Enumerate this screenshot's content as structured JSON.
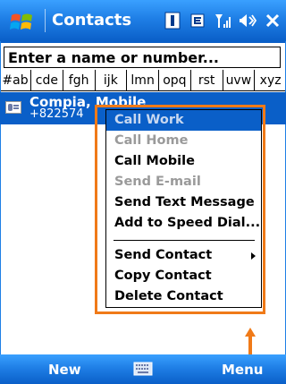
{
  "titlebar": {
    "app_title": "Contacts",
    "icons": [
      "windows-flag-icon",
      "sim-icon",
      "data-icon",
      "signal-icon",
      "speaker-icon",
      "close-icon"
    ]
  },
  "search": {
    "placeholder": "Enter a name or number..."
  },
  "alpha_tabs": [
    "#ab",
    "cde",
    "fgh",
    "ijk",
    "lmn",
    "opq",
    "rst",
    "uvw",
    "xyz"
  ],
  "contact": {
    "name": "Compia, Mobile",
    "number": "+822574"
  },
  "context_menu": {
    "items": [
      {
        "label": "Call Work",
        "state": "selected-disabled"
      },
      {
        "label": "Call Home",
        "state": "disabled"
      },
      {
        "label": "Call Mobile",
        "state": "enabled"
      },
      {
        "label": "Send E-mail",
        "state": "disabled"
      },
      {
        "label": "Send Text Message",
        "state": "enabled"
      },
      {
        "label": "Add to Speed Dial...",
        "state": "enabled"
      },
      {
        "label": "Send Contact",
        "state": "enabled",
        "submenu": true
      },
      {
        "label": "Copy Contact",
        "state": "enabled"
      },
      {
        "label": "Delete Contact",
        "state": "enabled"
      }
    ]
  },
  "softkeys": {
    "left": "New",
    "right": "Menu"
  },
  "colors": {
    "titlebar_blue": "#1f7fe6",
    "highlight_blue": "#0a5fc8",
    "annotation_orange": "#f07a18"
  }
}
